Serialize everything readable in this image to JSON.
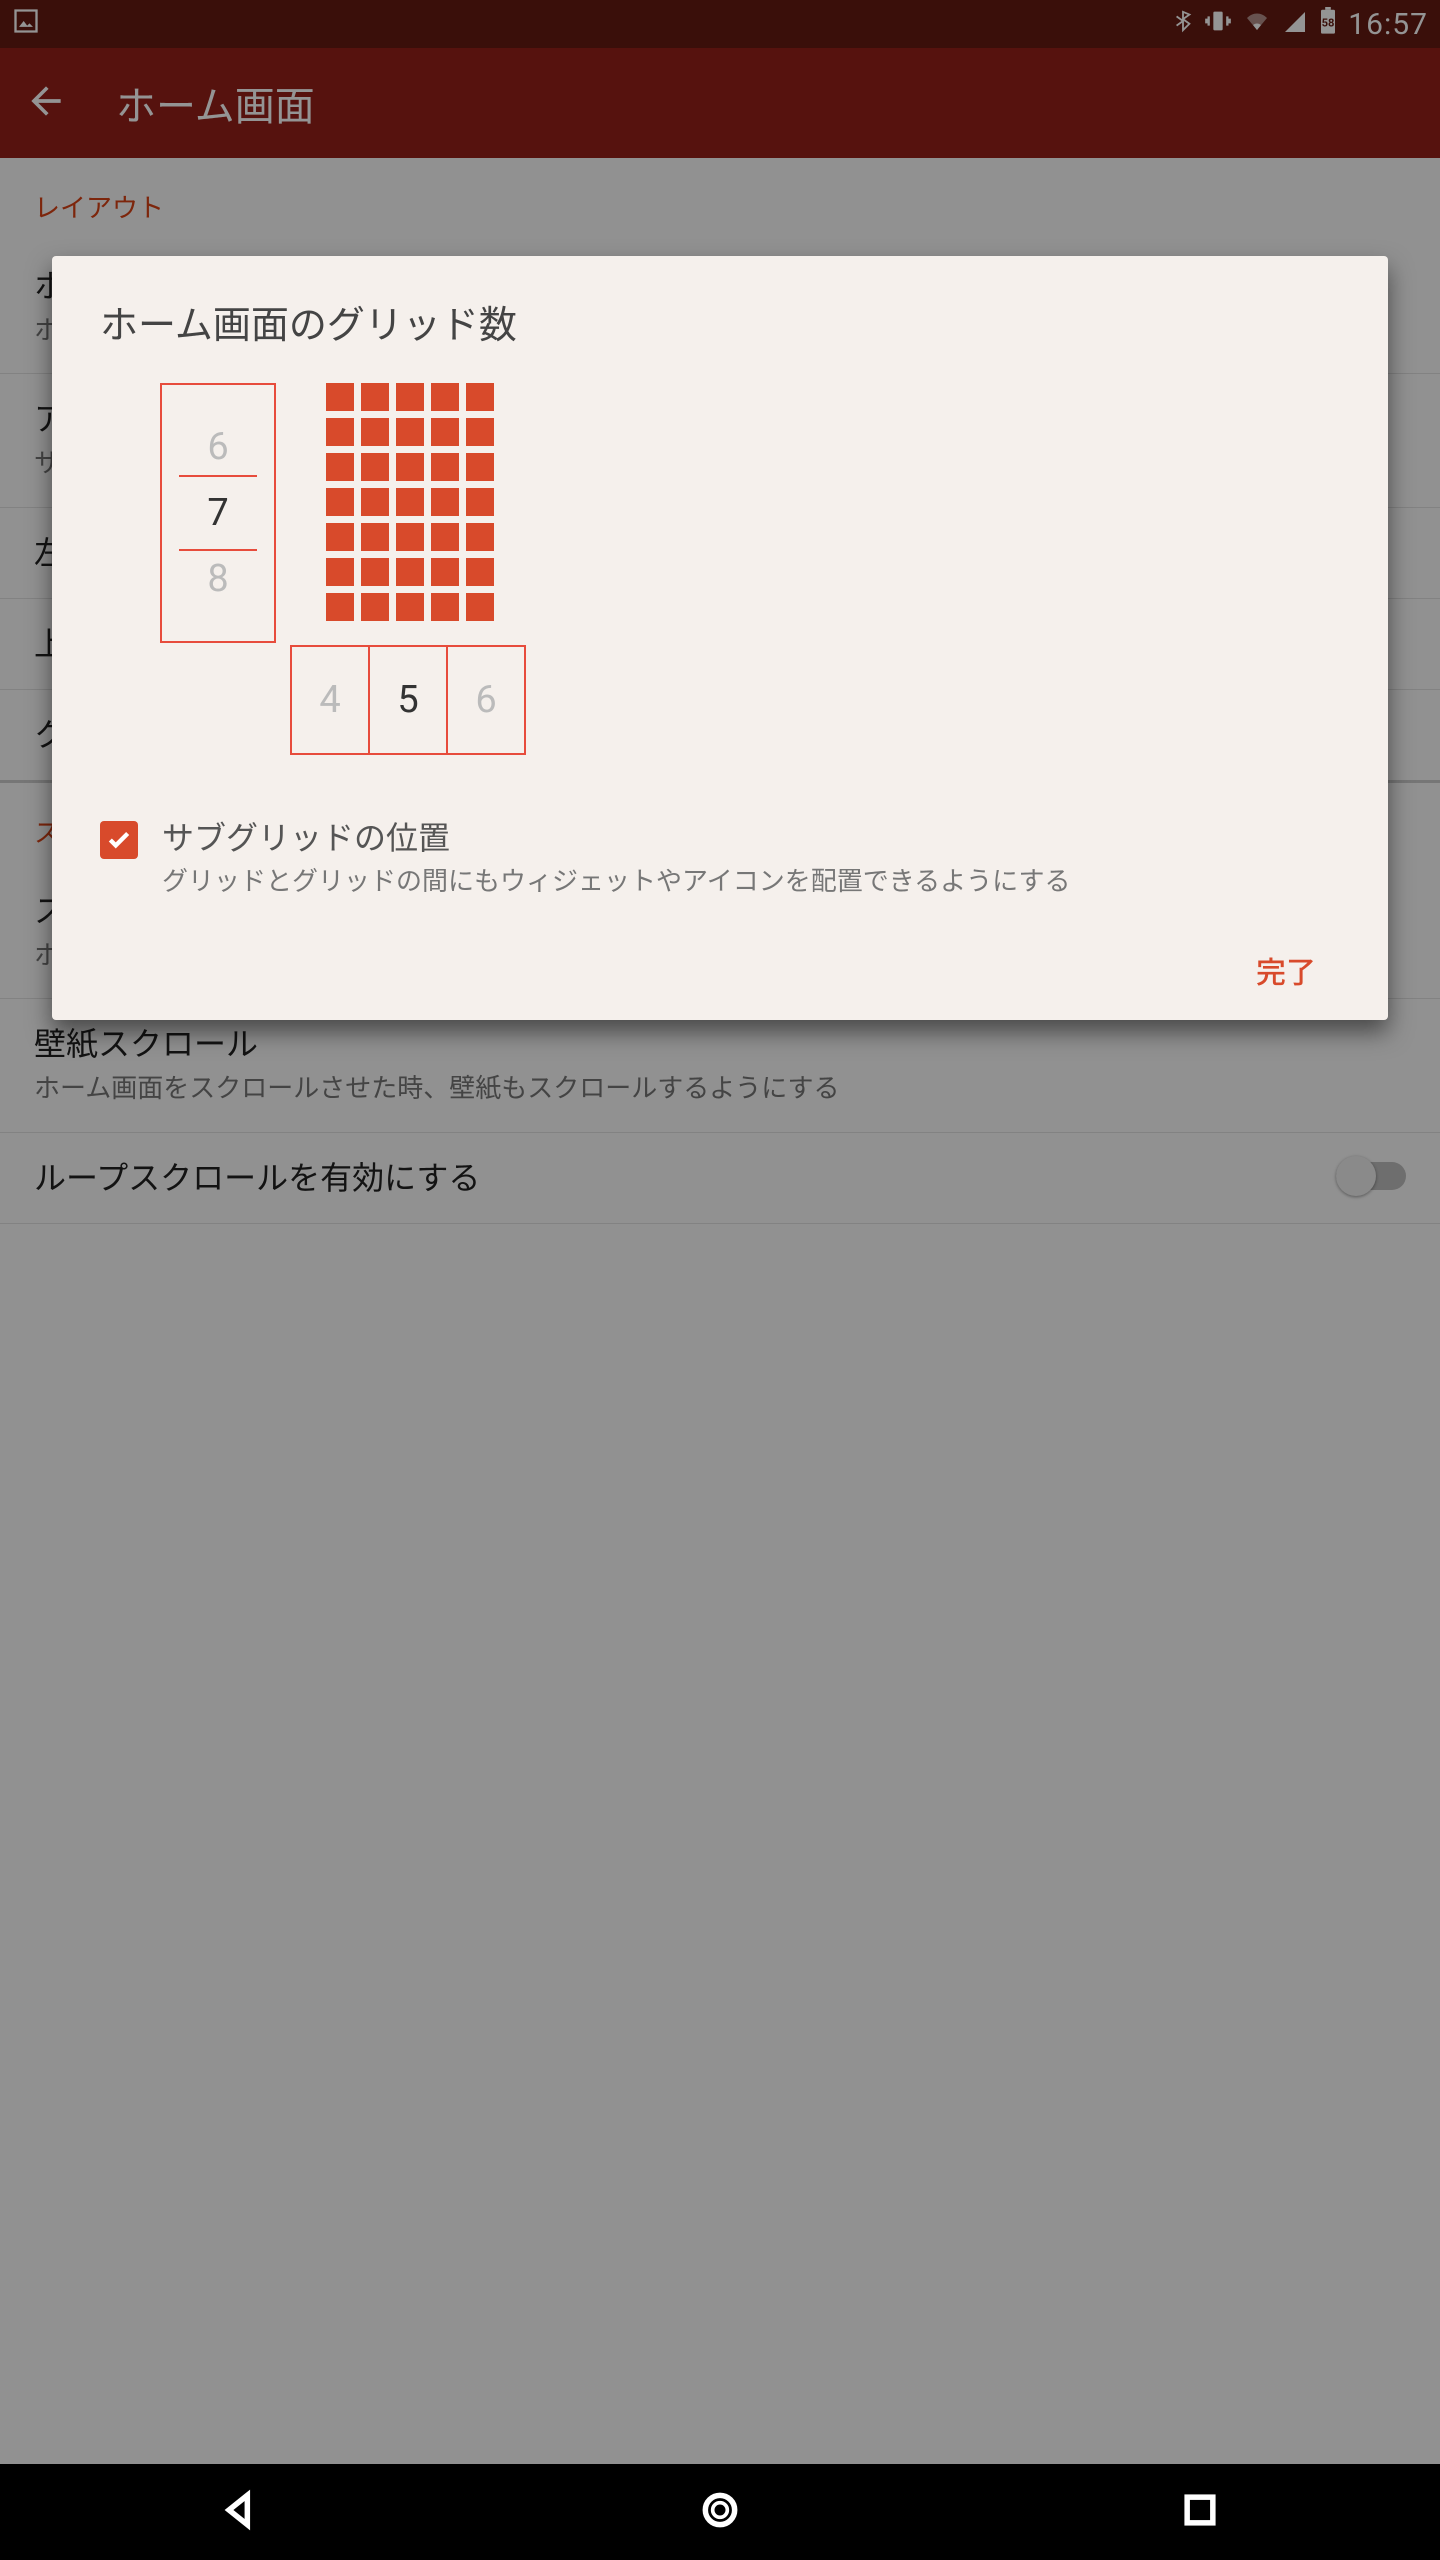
{
  "status": {
    "clock": "16:57",
    "battery_pct": "58"
  },
  "appbar": {
    "title": "ホーム画面"
  },
  "settings": {
    "section_layout": "レイアウト",
    "item1_title": "ホ",
    "item1_sub": "ホ",
    "item2_title": "ア",
    "item2_sub": "サ",
    "item3_title": "左",
    "item4_title": "上",
    "item5_title": "ク",
    "section_scroll": "ス",
    "item6_title": "ス",
    "item6_sub": "ホ",
    "item7_title": "壁紙スクロール",
    "item7_sub": "ホーム画面をスクロールさせた時、壁紙もスクロールするようにする",
    "item8_title": "ループスクロールを有効にする"
  },
  "dialog": {
    "title": "ホーム画面のグリッド数",
    "rows": {
      "prev": "6",
      "cur": "7",
      "next": "8"
    },
    "cols": {
      "prev": "4",
      "cur": "5",
      "next": "6"
    },
    "grid_rows": 7,
    "grid_cols": 5,
    "check_title": "サブグリッドの位置",
    "check_sub": "グリッドとグリッドの間にもウィジェットやアイコンを配置できるようにする",
    "done": "完了",
    "checked": true
  },
  "colors": {
    "accent": "#d84a2b"
  }
}
